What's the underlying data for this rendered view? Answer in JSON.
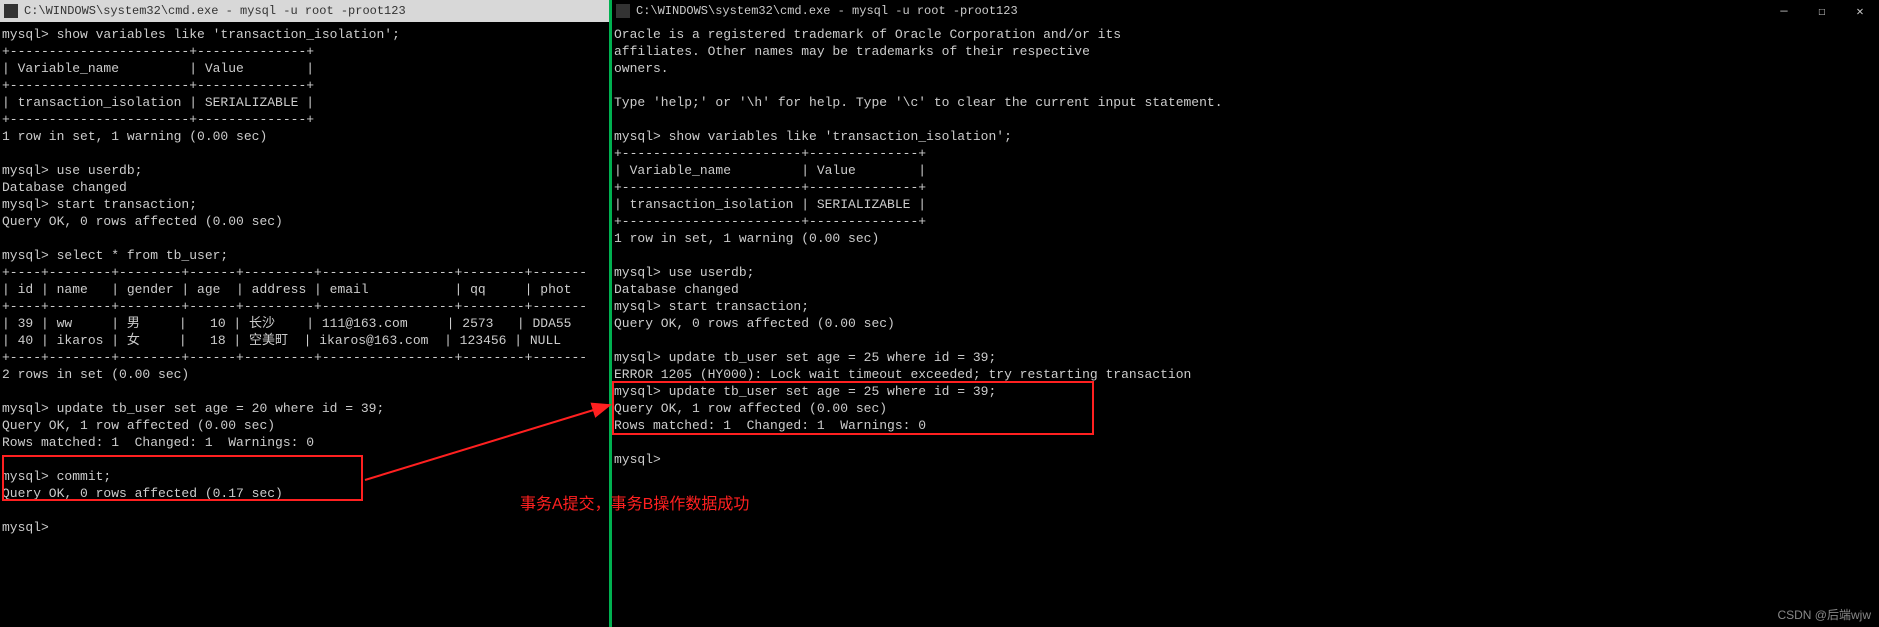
{
  "left": {
    "title": "C:\\WINDOWS\\system32\\cmd.exe - mysql  -u root -proot123",
    "lines": [
      "mysql> show variables like 'transaction_isolation';",
      "+-----------------------+--------------+",
      "| Variable_name         | Value        |",
      "+-----------------------+--------------+",
      "| transaction_isolation | SERIALIZABLE |",
      "+-----------------------+--------------+",
      "1 row in set, 1 warning (0.00 sec)",
      "",
      "mysql> use userdb;",
      "Database changed",
      "mysql> start transaction;",
      "Query OK, 0 rows affected (0.00 sec)",
      "",
      "mysql> select * from tb_user;",
      "+----+--------+--------+------+---------+-----------------+--------+-------",
      "| id | name   | gender | age  | address | email           | qq     | phot",
      "+----+--------+--------+------+---------+-----------------+--------+-------",
      "| 39 | ww     | 男     |   10 | 长沙    | 111@163.com     | 2573   | DDA55",
      "| 40 | ikaros | 女     |   18 | 空美町  | ikaros@163.com  | 123456 | NULL",
      "+----+--------+--------+------+---------+-----------------+--------+-------",
      "2 rows in set (0.00 sec)",
      "",
      "mysql> update tb_user set age = 20 where id = 39;",
      "Query OK, 1 row affected (0.00 sec)",
      "Rows matched: 1  Changed: 1  Warnings: 0",
      "",
      "mysql> commit;",
      "Query OK, 0 rows affected (0.17 sec)",
      "",
      "mysql>"
    ]
  },
  "right": {
    "title": "C:\\WINDOWS\\system32\\cmd.exe - mysql  -u root -proot123",
    "lines": [
      "Oracle is a registered trademark of Oracle Corporation and/or its",
      "affiliates. Other names may be trademarks of their respective",
      "owners.",
      "",
      "Type 'help;' or '\\h' for help. Type '\\c' to clear the current input statement.",
      "",
      "mysql> show variables like 'transaction_isolation';",
      "+-----------------------+--------------+",
      "| Variable_name         | Value        |",
      "+-----------------------+--------------+",
      "| transaction_isolation | SERIALIZABLE |",
      "+-----------------------+--------------+",
      "1 row in set, 1 warning (0.00 sec)",
      "",
      "mysql> use userdb;",
      "Database changed",
      "mysql> start transaction;",
      "Query OK, 0 rows affected (0.00 sec)",
      "",
      "mysql> update tb_user set age = 25 where id = 39;",
      "ERROR 1205 (HY000): Lock wait timeout exceeded; try restarting transaction",
      "mysql> update tb_user set age = 25 where id = 39;",
      "Query OK, 1 row affected (0.00 sec)",
      "Rows matched: 1  Changed: 1  Warnings: 0",
      "",
      "mysql>"
    ]
  },
  "annotation": "事务A提交，事务B操作数据成功",
  "watermark": "CSDN @后端wjw",
  "winbtns": {
    "min": "—",
    "max": "☐",
    "close": "✕"
  }
}
